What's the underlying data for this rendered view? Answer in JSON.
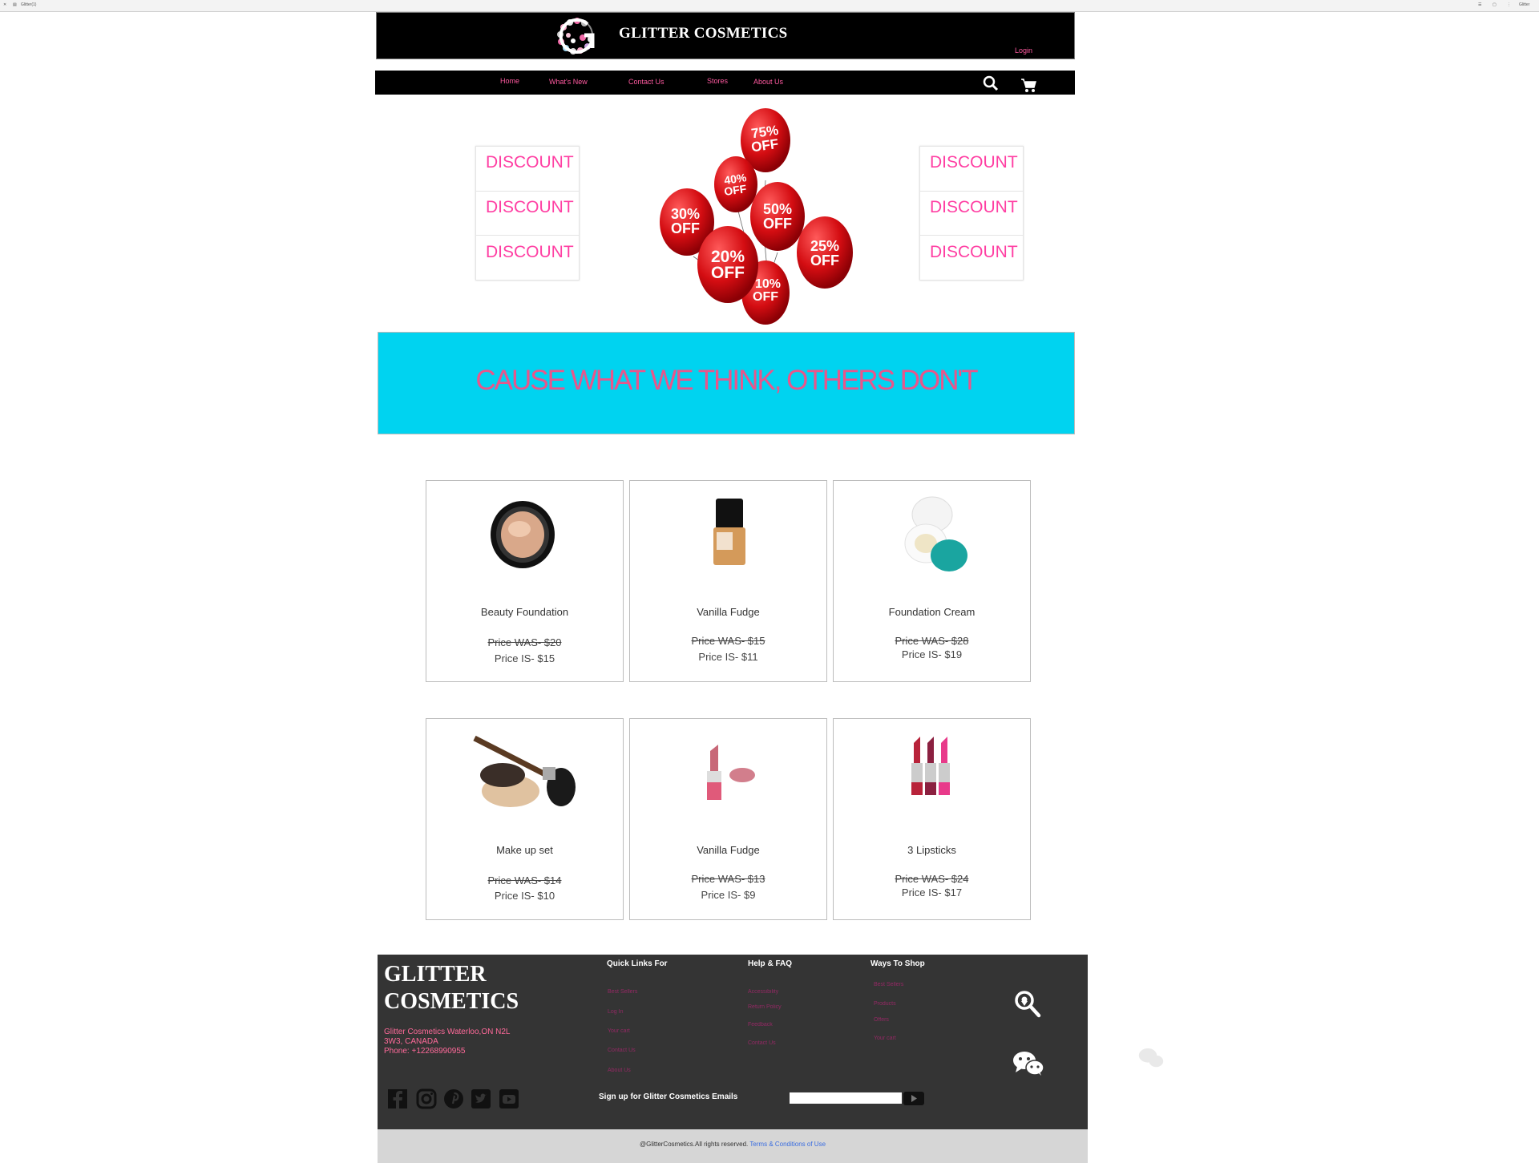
{
  "browser": {
    "tab_title": "Glitter(1)",
    "corner_text": "Glitter"
  },
  "header": {
    "brand": "GLITTER  COSMETICS",
    "login": "Login"
  },
  "nav": {
    "items": [
      "Home",
      "What's New",
      "Contact Us",
      "Stores",
      "About Us"
    ]
  },
  "discounts": {
    "left": [
      "DISCOUNT",
      "DISCOUNT",
      "DISCOUNT"
    ],
    "right": [
      "DISCOUNT",
      "DISCOUNT",
      "DISCOUNT"
    ]
  },
  "balloons": [
    {
      "pct": "75%",
      "off": "OFF"
    },
    {
      "pct": "40%",
      "off": "OFF"
    },
    {
      "pct": "30%",
      "off": "OFF"
    },
    {
      "pct": "50%",
      "off": "OFF"
    },
    {
      "pct": "20%",
      "off": "OFF"
    },
    {
      "pct": "25%",
      "off": "OFF"
    },
    {
      "pct": "10%",
      "off": "OFF"
    }
  ],
  "banner": {
    "slogan": "CAUSE WHAT WE THINK, OTHERS DON'T"
  },
  "products": [
    {
      "name": "Beauty Foundation",
      "was": "Price  WAS- $20",
      "is": "Price  IS- $15"
    },
    {
      "name": "Vanilla Fudge",
      "was": "Price  WAS- $15",
      "is": "Price  IS- $11"
    },
    {
      "name": "Foundation Cream",
      "was": "Price  WAS- $28",
      "is": "Price  IS- $19"
    },
    {
      "name": "Make up set",
      "was": "Price  WAS- $14",
      "is": "Price  IS- $10"
    },
    {
      "name": "Vanilla Fudge",
      "was": "Price  WAS- $13",
      "is": "Price  IS- $9"
    },
    {
      "name": "3 Lipsticks",
      "was": "Price  WAS- $24",
      "is": "Price  IS- $17"
    }
  ],
  "footer": {
    "brand_line1": "GLITTER",
    "brand_line2": "COSMETICS",
    "address_line1": "Glitter Cosmetics Waterloo,ON  N2L",
    "address_line2": "3W3, CANADA",
    "phone": "Phone: +12268990955",
    "quick_links": {
      "heading": "Quick Links For",
      "links": [
        "Best Sellers",
        "Log In",
        "Your cart",
        "Contact Us",
        "About Us"
      ]
    },
    "help": {
      "heading": "Help & FAQ",
      "links": [
        "Accessibility",
        "Return Policy",
        "Feedback",
        "Contact Us"
      ]
    },
    "ways": {
      "heading": "Ways To Shop",
      "links": [
        "Best Sellers",
        "Products",
        "Offers",
        "Your cart"
      ]
    },
    "signup_label": "Sign up for Glitter Cosmetics Emails",
    "email_placeholder": ""
  },
  "copyright": {
    "text": "@GlitterCosmetics.All rights reserved. ",
    "terms": "Terms & Conditions of Use"
  },
  "colors": {
    "accent_pink": "#ff3fa3",
    "banner_cyan": "#00d3f0",
    "footer_bg": "#343434"
  }
}
